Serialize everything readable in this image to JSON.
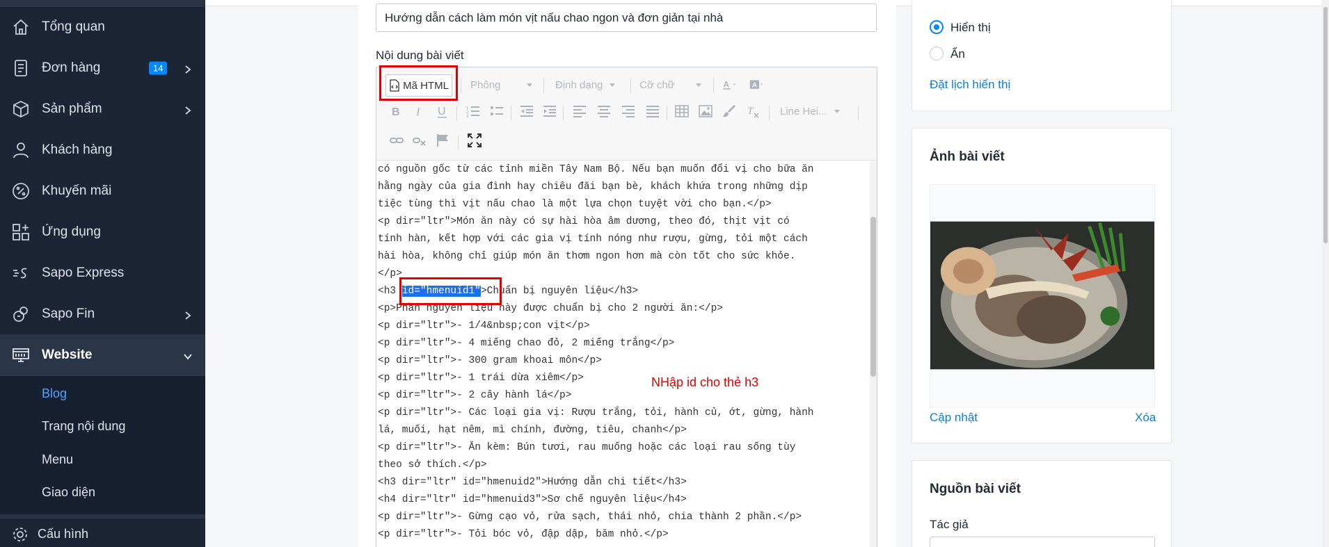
{
  "sidebar": {
    "items": [
      {
        "label": "Tổng quan",
        "icon": "home-icon"
      },
      {
        "label": "Đơn hàng",
        "icon": "orders-icon",
        "badge": "14"
      },
      {
        "label": "Sản phẩm",
        "icon": "box-icon"
      },
      {
        "label": "Khách hàng",
        "icon": "user-icon"
      },
      {
        "label": "Khuyến mãi",
        "icon": "discount-icon"
      },
      {
        "label": "Ứng dụng",
        "icon": "apps-icon"
      },
      {
        "label": "Sapo Express",
        "icon": "express-icon"
      },
      {
        "label": "Sapo Fin",
        "icon": "finance-icon"
      },
      {
        "label": "Website",
        "icon": "website-icon"
      }
    ],
    "sub_items": [
      "Blog",
      "Trang nội dung",
      "Menu",
      "Giao diện"
    ],
    "bottom_label": "Cấu hình",
    "accent": "#0088ff"
  },
  "main": {
    "title_value": "Hướng dẫn cách làm món vịt nấu chao ngon và đơn giản tại nhà",
    "content_label": "Nội dung bài viết",
    "toolbar": {
      "html_button": "Mã HTML",
      "font_dropdown": "Phông",
      "format_dropdown": "Định dạng",
      "size_dropdown": "Cỡ chữ",
      "line_height_dropdown": "Line Hei..."
    },
    "code_lines": [
      "có nguồn gốc từ các tỉnh miền Tây Nam Bộ. Nếu bạn muốn đổi vị cho bữa ăn",
      "hằng ngày của gia đình hay chiêu đãi bạn bè, khách khứa trong những dịp",
      "tiệc tùng thì vịt nấu chao là một lựa chọn tuyệt vời cho bạn.</p>",
      "<p dir=\"ltr\">Món ăn này có sự hài hòa âm dương, theo đó, thịt vịt có",
      "tính hàn, kết hợp với các gia vị tính nóng như rượu, gừng, tỏi một cách",
      "hài hòa, không chỉ giúp món ăn thơm ngon hơn mà còn tốt cho sức khỏe.",
      "</p>",
      "<h3 ",
      "<p>Phần nguyên liệu này được chuẩn bị cho 2 người ăn:</p>",
      "<p dir=\"ltr\">- 1/4&nbsp;con vịt</p>",
      "<p dir=\"ltr\">- 4 miếng chao đỏ, 2 miếng trắng</p>",
      "<p dir=\"ltr\">- 300 gram khoai môn</p>",
      "<p dir=\"ltr\">- 1 trái dừa xiêm</p>",
      "<p dir=\"ltr\">- 2 cây hành lá</p>",
      "<p dir=\"ltr\">- Các loại gia vị: Rượu trắng, tỏi, hành củ, ớt, gừng, hành",
      "lá, muối, hạt nêm, mì chính, đường, tiêu, chanh</p>",
      "<p dir=\"ltr\">- Ăn kèm: Bún tươi, rau muống hoặc các loại rau sống tùy",
      "theo sở thích.</p>",
      "<h3 dir=\"ltr\" id=\"hmenuid2\">Hướng dẫn chi tiết</h3>",
      "<h4 dir=\"ltr\" id=\"hmenuid3\">Sơ chế nguyên liệu</h4>",
      "<p dir=\"ltr\">- Gừng cạo vỏ, rửa sạch, thái nhỏ, chia thành 2 phần.</p>",
      "<p dir=\"ltr\">- Tỏi bóc vỏ, đập dập, băm nhỏ.</p>"
    ],
    "h3_highlight": "id=\"hmenuid1\"",
    "h3_rest": ">Chuẩn bị nguyên liệu</h3>",
    "annotation": "NHập id cho thẻ h3",
    "annotation_color": "#e00000"
  },
  "right": {
    "visibility": {
      "options": [
        "Hiển thị",
        "Ẩn"
      ],
      "selected": "Hiển thị",
      "schedule_link": "Đặt lịch hiển thị"
    },
    "image_card": {
      "title": "Ảnh bài viết",
      "update_link": "Cập nhật",
      "delete_link": "Xóa"
    },
    "source_card": {
      "title": "Nguồn bài viết",
      "author_label": "Tác giả"
    }
  }
}
